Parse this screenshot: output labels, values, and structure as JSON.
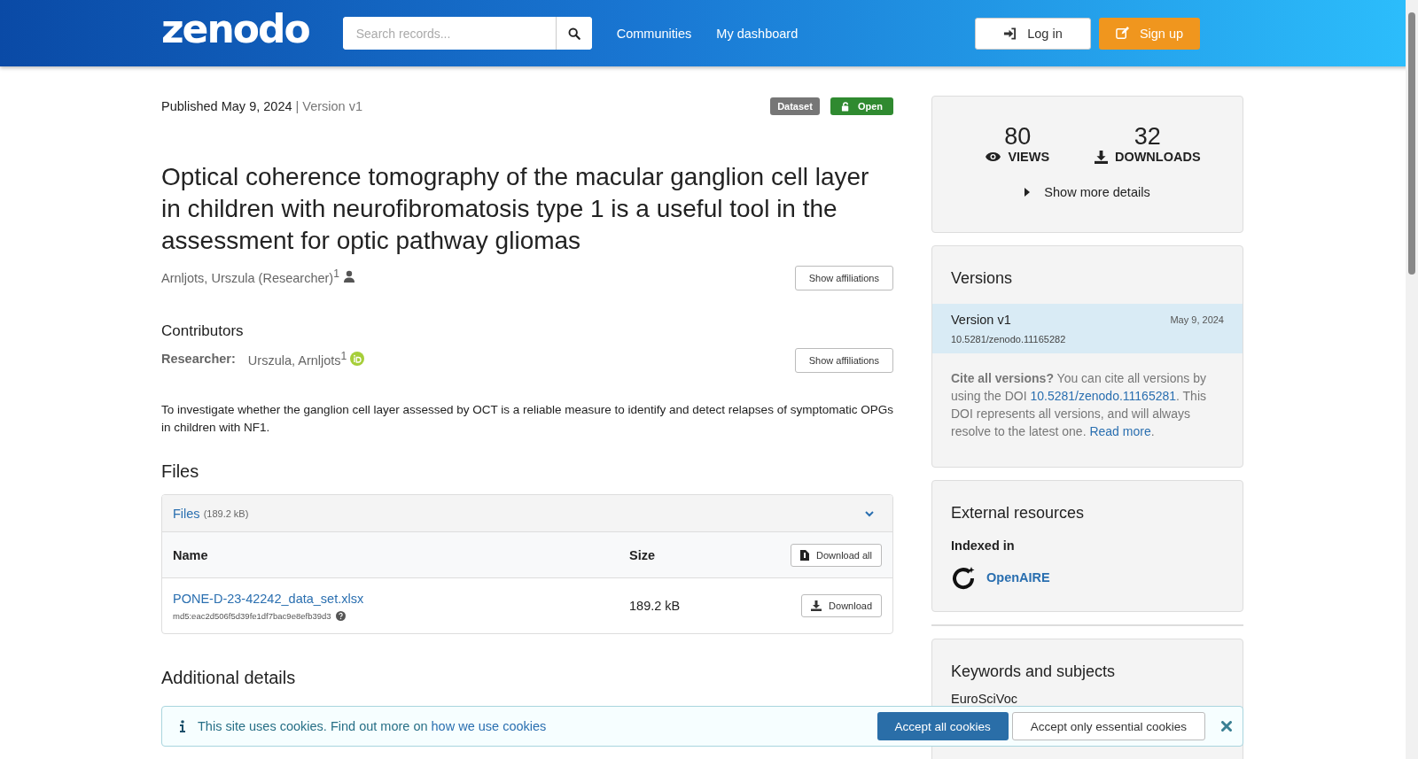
{
  "header": {
    "logo": "zenodo",
    "search": {
      "placeholder": "Search records..."
    },
    "nav": [
      "Communities",
      "My dashboard"
    ],
    "login": "Log in",
    "signup": "Sign up"
  },
  "record": {
    "published": "Published May 9, 2024",
    "version": "| Version v1",
    "badges": [
      {
        "label": "Dataset",
        "kind": "type"
      },
      {
        "label": "Open",
        "kind": "access"
      }
    ],
    "title": "Optical coherence tomography of the macular ganglion cell layer in children with neurofibromatosis type 1 is a useful tool in the assessment for optic pathway gliomas",
    "creators": [
      {
        "name": "Arnljots, Urszula (Researcher)$^{1}$"
      }
    ],
    "creators_button": "Show affiliations",
    "contributors": {
      "heading": "Contributors",
      "items": [
        {
          "role": "Researcher:",
          "name": "Urszula, Arnljots$^{1}$",
          "orcid": true
        }
      ],
      "button": "Show affiliations"
    },
    "description": "To investigate whether the ganglion cell layer assessed by OCT is a reliable measure to identify and detect relapses of symptomatic OPGs in children with NF1.",
    "files": {
      "heading": "Files",
      "panel_title": "Files",
      "panel_size": "(189.2 kB)",
      "expanded": true,
      "columns": [
        "Name",
        "Size"
      ],
      "download_all": "Download all",
      "rows": [
        {
          "name": "PONE-D-23-42242_data_set.xlsx",
          "checksum": "md5:eac2d506f5d39fe1df7bac9e8efb39d3",
          "size": "189.2 kB",
          "action": "Download"
        }
      ]
    },
    "additional_heading": "Additional details"
  },
  "sidebar": {
    "stats": [
      {
        "value": "80",
        "label": "VIEWS",
        "kind": "views"
      },
      {
        "value": "32",
        "label": "DOWNLOADS",
        "kind": "downloads"
      }
    ],
    "show_more": "Show more details",
    "versions": {
      "heading": "Versions",
      "items": [
        {
          "label": "Version v1",
          "date": "May 9, 2024",
          "doi": "10.5281/zenodo.11165282",
          "selected": true
        }
      ],
      "cite": [
        {
          "kind": "text",
          "text": "**Cite all versions?** You can cite all versions by using the DOI "
        },
        {
          "kind": "link",
          "text": "10.5281/zenodo.11165281"
        },
        {
          "kind": "text",
          "text": ". This DOI represents all versions, and will always resolve to the latest one. "
        },
        {
          "kind": "link",
          "text": "Read more"
        },
        {
          "kind": "text",
          "text": "."
        }
      ]
    },
    "external": {
      "heading": "External resources",
      "subheading": "Indexed in",
      "items": [
        {
          "name": "OpenAIRE"
        }
      ]
    },
    "keywords": {
      "heading": "Keywords and subjects",
      "items": [
        "EuroSciVoc"
      ]
    }
  },
  "cookie_banner": {
    "text": "This site uses cookies. Find out more on ",
    "link": "how we use cookies",
    "accept_all": "Accept all cookies",
    "accept_essential": "Accept only essential cookies"
  }
}
